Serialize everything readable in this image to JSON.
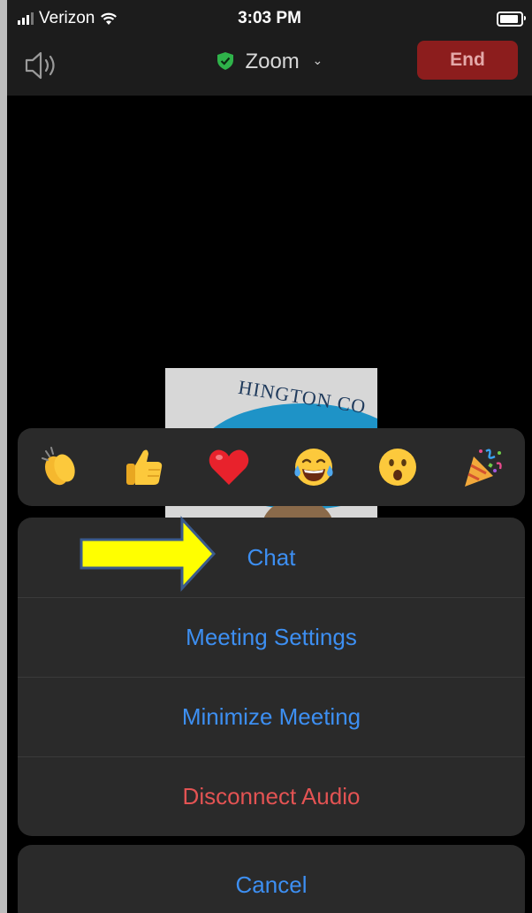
{
  "status_bar": {
    "carrier": "Verizon",
    "time": "3:03 PM"
  },
  "toolbar": {
    "speaker_icon": "speaker-icon",
    "title": "Zoom",
    "end_label": "End"
  },
  "shared_content": {
    "visible_text": "HINGTON CO"
  },
  "reactions": [
    {
      "name": "clapping-hands",
      "emoji": "👏"
    },
    {
      "name": "thumbs-up",
      "emoji": "👍"
    },
    {
      "name": "heart",
      "emoji": "❤️"
    },
    {
      "name": "tears-of-joy",
      "emoji": "😂"
    },
    {
      "name": "open-mouth",
      "emoji": "😮"
    },
    {
      "name": "party-popper",
      "emoji": "🎉"
    }
  ],
  "menu": {
    "chat": "Chat",
    "meeting_settings": "Meeting Settings",
    "minimize_meeting": "Minimize Meeting",
    "disconnect_audio": "Disconnect Audio",
    "cancel": "Cancel"
  },
  "colors": {
    "accent": "#3d8ff2",
    "danger": "#e35353",
    "end_button": "#8c1d1d",
    "annotation_arrow": "#ffff00"
  }
}
